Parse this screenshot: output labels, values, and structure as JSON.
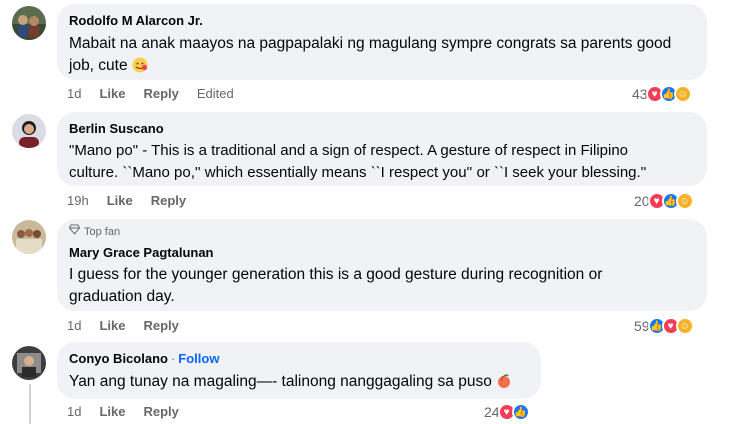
{
  "comments": [
    {
      "author": "Rodolfo M Alarcon Jr.",
      "text_line1": "Mabait na anak maayos na pagpapalaki ng magulang sympre congrats sa parents good",
      "text_line2": "job, cute",
      "time": "1d",
      "like": "Like",
      "reply": "Reply",
      "edited": "Edited",
      "reaction_count": "43",
      "reactions": [
        "heart-icon",
        "like-icon",
        "care-icon"
      ]
    },
    {
      "author": "Berlin Suscano",
      "text_line1": "\"Mano po\" - This is a traditional and a sign of respect. A gesture of respect in Filipino",
      "text_line2": "culture. ``Mano po,'' which essentially means ``I respect you'' or ``I seek your blessing.''",
      "time": "19h",
      "like": "Like",
      "reply": "Reply",
      "reaction_count": "20",
      "reactions": [
        "heart-icon",
        "like-icon",
        "care-icon"
      ]
    },
    {
      "badge": "Top fan",
      "author": "Mary Grace Pagtalunan",
      "text_line1": "I guess for the younger generation this is a good gesture during recognition or",
      "text_line2": "graduation day.",
      "time": "1d",
      "like": "Like",
      "reply": "Reply",
      "reaction_count": "59",
      "reactions": [
        "like-icon",
        "heart-icon",
        "care-icon"
      ]
    },
    {
      "author": "Conyo Bicolano",
      "follow": "Follow",
      "separator": "·",
      "text_line1": "Yan ang tunay na magaling—- talinong nanggagaling sa puso",
      "time": "1d",
      "like": "Like",
      "reply": "Reply",
      "reaction_count": "24",
      "reactions": [
        "heart-icon",
        "like-icon"
      ]
    }
  ],
  "colors": {
    "bubble": "#f0f2f5",
    "meta": "#65676b",
    "follow": "#0866ff",
    "heart": "#f33e58",
    "like": "#1877f2",
    "care": "#f7b125"
  }
}
